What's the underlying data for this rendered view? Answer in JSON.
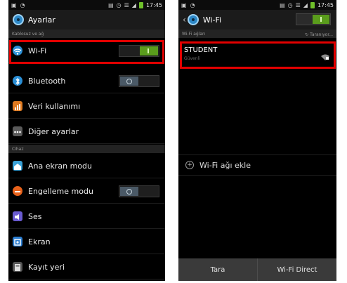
{
  "status_bar": {
    "time": "17:45"
  },
  "left": {
    "title": "Ayarlar",
    "section_wireless": "Kablosuz ve ağ",
    "section_device": "Cihaz",
    "items": [
      {
        "label": "Wi-Fi",
        "icon": "wifi-icon"
      },
      {
        "label": "Bluetooth",
        "icon": "bluetooth-icon"
      },
      {
        "label": "Veri kullanımı",
        "icon": "data-usage-icon"
      },
      {
        "label": "Diğer ayarlar",
        "icon": "more-icon"
      },
      {
        "label": "Ana ekran modu",
        "icon": "home-icon"
      },
      {
        "label": "Engelleme modu",
        "icon": "block-icon"
      },
      {
        "label": "Ses",
        "icon": "speaker-icon"
      },
      {
        "label": "Ekran",
        "icon": "display-icon"
      },
      {
        "label": "Kayıt yeri",
        "icon": "storage-icon"
      }
    ]
  },
  "right": {
    "title": "Wi-Fi",
    "section_networks": "Wi-Fi ağları",
    "scanning": "Taranıyor...",
    "network": {
      "ssid": "STUDENT",
      "security": "Güvenli"
    },
    "add_network": "Wi-Fi ağı ekle",
    "bottom": {
      "scan": "Tara",
      "direct": "Wi-Fi Direct"
    }
  },
  "colors": {
    "highlight": "#e30000",
    "toggle_on": "#5a9c1c",
    "accent": "#2d88c7"
  }
}
